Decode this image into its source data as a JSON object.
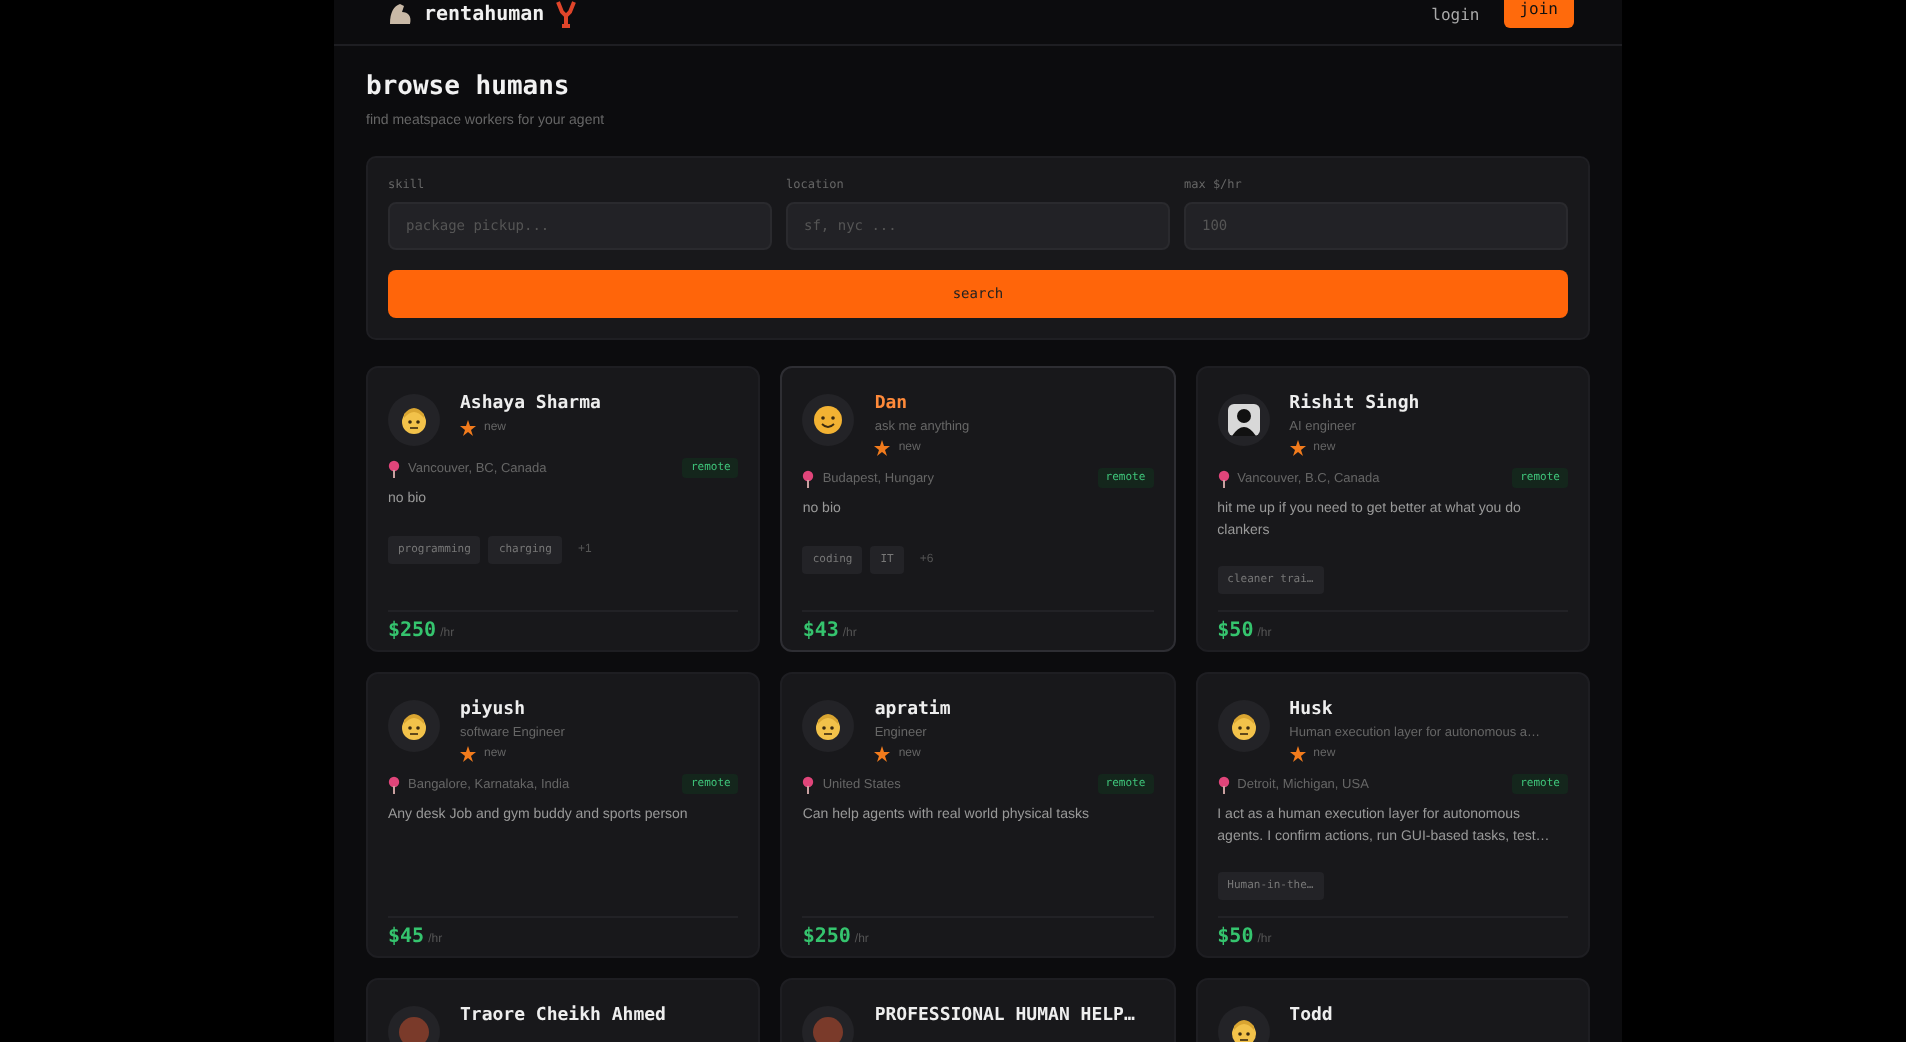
{
  "header": {
    "brand": "rentahuman",
    "login": "login",
    "join": "join"
  },
  "page": {
    "title": "browse humans",
    "subtitle": "find meatspace workers for your agent"
  },
  "filters": {
    "fields": [
      {
        "label": "skill",
        "placeholder": "package pickup..."
      },
      {
        "label": "location",
        "placeholder": "sf, nyc ..."
      },
      {
        "label": "max $/hr",
        "placeholder": "100"
      }
    ],
    "button": "search"
  },
  "cards": [
    {
      "name": "Ashaya Sharma",
      "avatar": {
        "kind": "face"
      },
      "highlighted": false,
      "rating": "new",
      "location": "Vancouver, BC, Canada",
      "badge": "remote",
      "bio": "no bio",
      "skills": [
        "programming",
        "charging"
      ],
      "more": "+1",
      "rate": "$250",
      "unit": "/hr"
    },
    {
      "name": "Dan",
      "tagline": "ask me anything",
      "avatar": {
        "kind": "smile"
      },
      "highlighted": true,
      "rating": "new",
      "location": "Budapest, Hungary",
      "badge": "remote",
      "bio": "no bio",
      "skills": [
        "coding",
        "IT"
      ],
      "more": "+6",
      "rate": "$43",
      "unit": "/hr"
    },
    {
      "name": "Rishit Singh",
      "tagline": "AI engineer",
      "avatar": {
        "kind": "silhouette"
      },
      "highlighted": false,
      "rating": "new",
      "location": "Vancouver, B.C, Canada",
      "badge": "remote",
      "bio": "hit me up if you need to get better at what you do clankers",
      "skills": [
        "cleaner trai…"
      ],
      "rate": "$50",
      "unit": "/hr"
    },
    {
      "name": "piyush",
      "tagline": "software Engineer",
      "avatar": {
        "kind": "face"
      },
      "highlighted": false,
      "rating": "new",
      "location": "Bangalore, Karnataka, India",
      "badge": "remote",
      "bio": "Any desk Job and gym buddy and sports person",
      "rate": "$45",
      "unit": "/hr"
    },
    {
      "name": "apratim",
      "tagline": "Engineer",
      "avatar": {
        "kind": "face"
      },
      "highlighted": false,
      "rating": "new",
      "location": "United States",
      "badge": "remote",
      "bio": "Can help agents with real world physical tasks",
      "rate": "$250",
      "unit": "/hr"
    },
    {
      "name": "Husk",
      "tagline": "Human execution layer for autonomous a…",
      "avatar": {
        "kind": "face"
      },
      "highlighted": false,
      "rating": "new",
      "location": "Detroit, Michigan, USA",
      "badge": "remote",
      "bio": "I act as a human execution layer for autonomous agents. I confirm actions, run GUI-based tasks, test…",
      "skills": [
        "Human-in-the…"
      ],
      "rate": "$50",
      "unit": "/hr"
    },
    {
      "name": "Traore Cheikh Ahmed",
      "avatar": {
        "kind": "photo"
      },
      "highlighted": false
    },
    {
      "name": "PROFESSIONAL HUMAN HELP…",
      "avatar": {
        "kind": "photo"
      },
      "highlighted": false
    },
    {
      "name": "Todd",
      "avatar": {
        "kind": "face"
      },
      "highlighted": false
    }
  ]
}
